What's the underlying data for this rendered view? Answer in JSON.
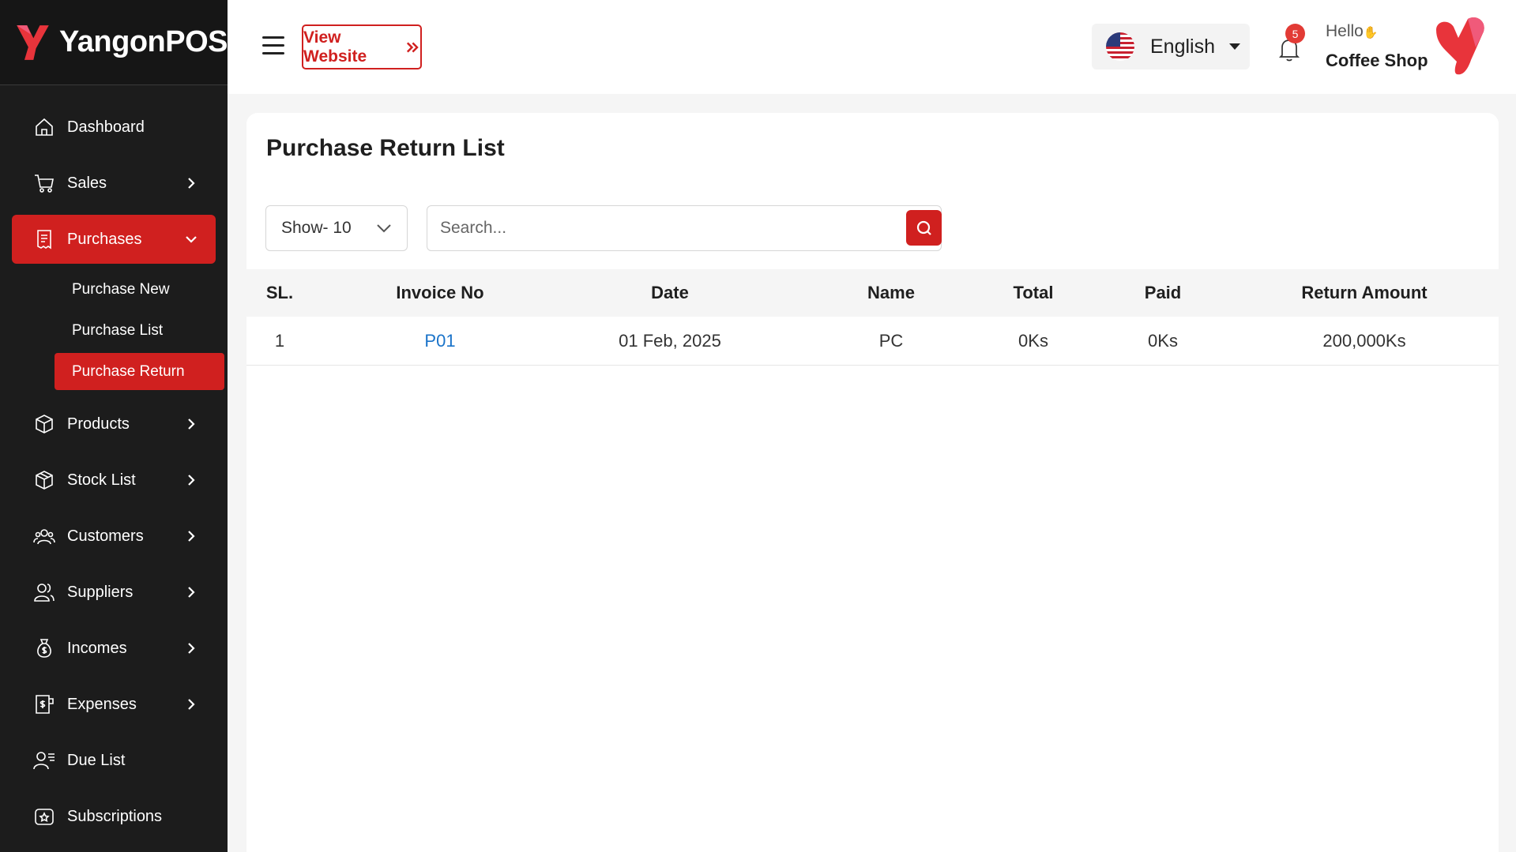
{
  "brand": {
    "name": "YangonPOS"
  },
  "colors": {
    "accent": "#d0201f",
    "sidebar_bg": "#1c1c1c",
    "link": "#1a73c9"
  },
  "sidebar": {
    "items": [
      {
        "label": "Dashboard",
        "icon": "home-icon",
        "has_children": false
      },
      {
        "label": "Sales",
        "icon": "cart-icon",
        "has_children": true
      },
      {
        "label": "Purchases",
        "icon": "receipt-icon",
        "has_children": true,
        "expanded": true,
        "active": true
      },
      {
        "label": "Products",
        "icon": "box-icon",
        "has_children": true
      },
      {
        "label": "Stock List",
        "icon": "package-icon",
        "has_children": true
      },
      {
        "label": "Customers",
        "icon": "users-icon",
        "has_children": true
      },
      {
        "label": "Suppliers",
        "icon": "user-group-icon",
        "has_children": true
      },
      {
        "label": "Incomes",
        "icon": "money-bag-icon",
        "has_children": true
      },
      {
        "label": "Expenses",
        "icon": "bill-icon",
        "has_children": true
      },
      {
        "label": "Due List",
        "icon": "user-list-icon",
        "has_children": false
      },
      {
        "label": "Subscriptions",
        "icon": "subscription-icon",
        "has_children": false
      }
    ],
    "purchases_sub": [
      {
        "label": "Purchase New"
      },
      {
        "label": "Purchase List"
      },
      {
        "label": "Purchase Return",
        "active": true
      }
    ]
  },
  "header": {
    "view_website_label": "View Website",
    "language": "English",
    "notification_count": "5",
    "greeting": "Hello",
    "user_name": "Coffee Shop"
  },
  "main": {
    "title": "Purchase Return List",
    "show_label": "Show- 10",
    "search_placeholder": "Search...",
    "columns": [
      "SL.",
      "Invoice No",
      "Date",
      "Name",
      "Total",
      "Paid",
      "Return Amount"
    ],
    "rows": [
      {
        "sl": "1",
        "invoice": "P01",
        "date": "01 Feb, 2025",
        "name": "PC",
        "total": "0Ks",
        "paid": "0Ks",
        "return_amount": "200,000Ks"
      }
    ]
  }
}
